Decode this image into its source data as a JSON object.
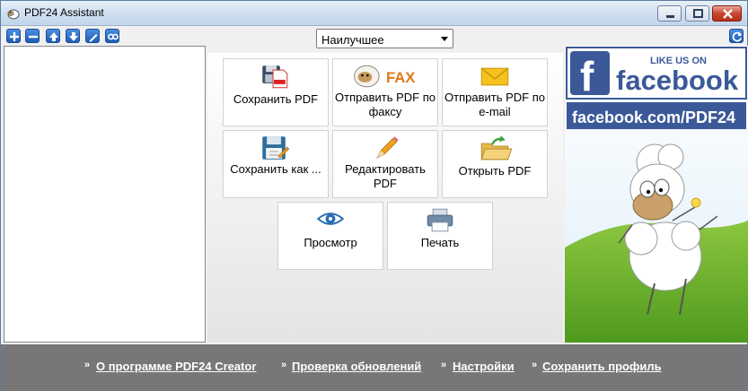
{
  "window": {
    "title": "PDF24 Assistant"
  },
  "toolbar": {
    "buttons": [
      "add-icon",
      "remove-icon",
      "move-up-icon",
      "move-down-icon",
      "edit-icon",
      "merge-icon"
    ]
  },
  "quality_select": {
    "value": "Наилучшее"
  },
  "actions": {
    "save_pdf": "Сохранить PDF",
    "fax_pdf": "Отправить PDF по факсу",
    "email_pdf": "Отправить PDF по e-mail",
    "save_as": "Сохранить как ...",
    "edit_pdf": "Редактировать PDF",
    "open_pdf": "Открыть PDF",
    "preview": "Просмотр",
    "print": "Печать",
    "fax_badge": "FAX"
  },
  "ad": {
    "like_us": "LIKE US ON",
    "brand": "facebook",
    "url": "facebook.com/PDF24"
  },
  "footer": {
    "bullet": "»",
    "about": "О программе PDF24 Creator",
    "check_updates": "Проверка обновлений",
    "settings": "Настройки",
    "save_profile": "Сохранить профиль"
  },
  "colors": {
    "footer_bg": "#777777",
    "facebook_blue": "#3b5998",
    "toolbar_blue": "#1f5cb4",
    "grass_green": "#6ab52a"
  }
}
